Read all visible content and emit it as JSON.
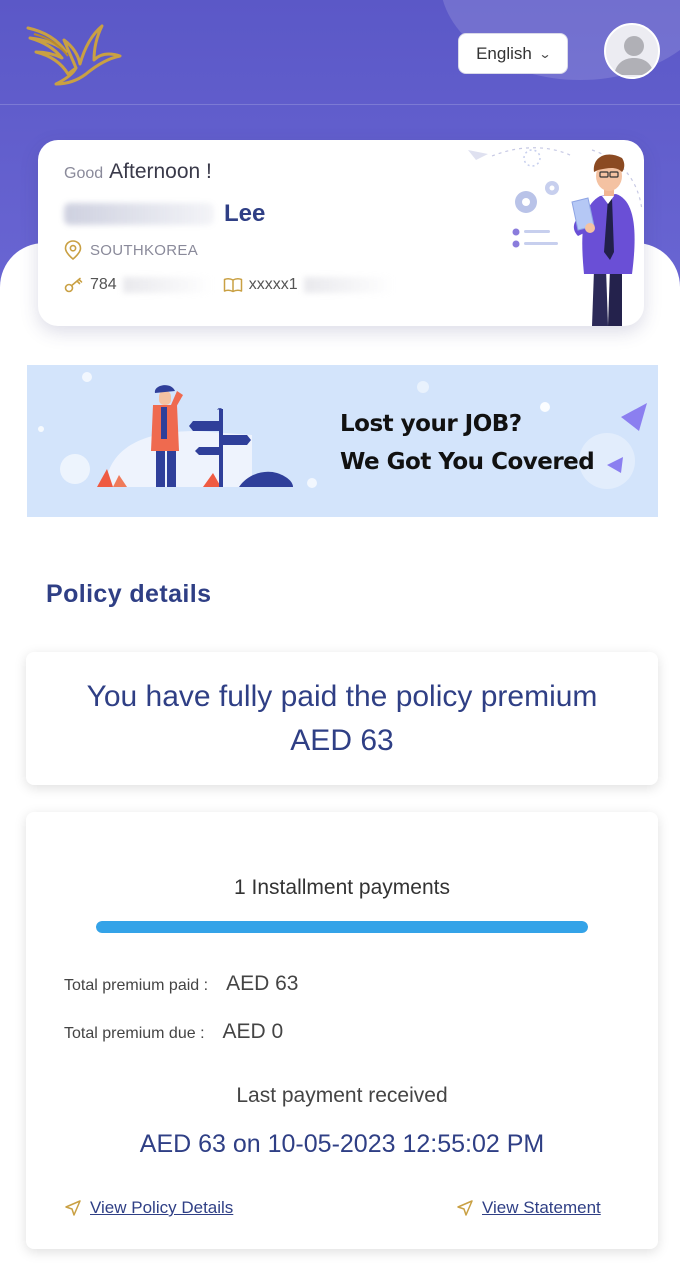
{
  "header": {
    "language": "English",
    "language_chevron_icon": "chevron-down-icon",
    "avatar_icon": "user-avatar-icon",
    "logo_icon": "golden-eagle-logo-icon",
    "brand_color": "#5b58c7"
  },
  "greeting": {
    "prefix": "Good",
    "period": "Afternoon !",
    "last_name": "Lee",
    "country": "SOUTHKOREA",
    "id_number": "784",
    "passport_number": "xxxxx1"
  },
  "banner": {
    "line1": "Lost your JOB?",
    "line2": "We Got You Covered"
  },
  "policy": {
    "section_title": "Policy details",
    "paid_message": "You have fully paid the policy premium AED 63",
    "installments_label": "1 Installment payments",
    "progress_fraction": 1.0,
    "progress_color": "#34a3e8",
    "total_paid_label": "Total premium paid :",
    "total_paid_value": "AED 63",
    "total_due_label": "Total premium due :",
    "total_due_value": "AED 0",
    "last_payment_label": "Last payment received",
    "last_payment_value": "AED 63 on 10-05-2023 12:55:02 PM",
    "view_policy_link": "View Policy Details",
    "view_statement_link": "View Statement"
  }
}
